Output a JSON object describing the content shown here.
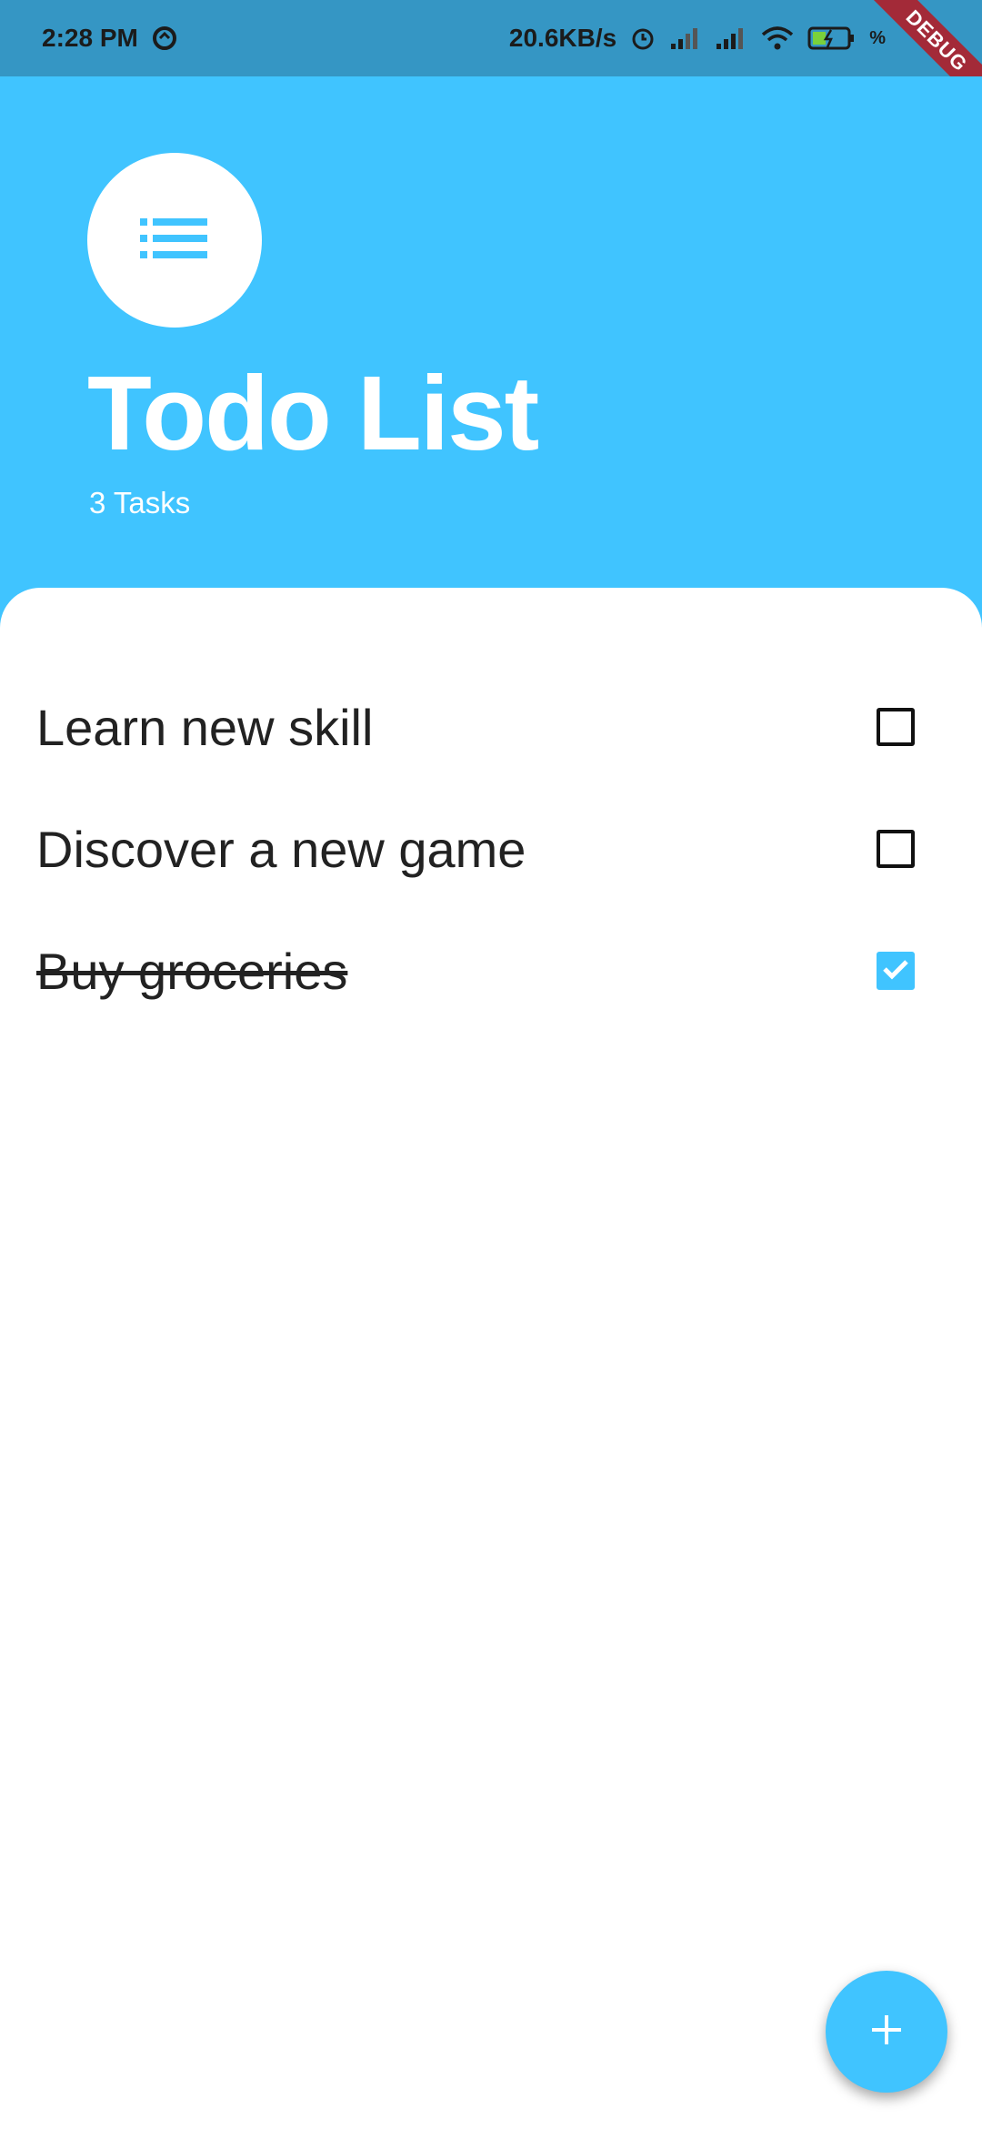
{
  "status_bar": {
    "time": "2:28 PM",
    "network_speed": "20.6KB/s",
    "battery_text": "%",
    "icons": [
      "sync-icon",
      "alarm-icon",
      "signal-icon",
      "signal-icon",
      "wifi-icon",
      "battery-charging-icon"
    ]
  },
  "debug_banner": "DEBUG",
  "header": {
    "icon": "list-icon",
    "title": "Todo List",
    "task_count": "3 Tasks"
  },
  "tasks": [
    {
      "title": "Learn new skill",
      "completed": false
    },
    {
      "title": "Discover a new game",
      "completed": false
    },
    {
      "title": "Buy groceries",
      "completed": true
    }
  ],
  "fab": {
    "icon": "add-icon"
  },
  "colors": {
    "accent": "#40C4FF",
    "status_bar": "#3596c4",
    "text": "#222222"
  }
}
